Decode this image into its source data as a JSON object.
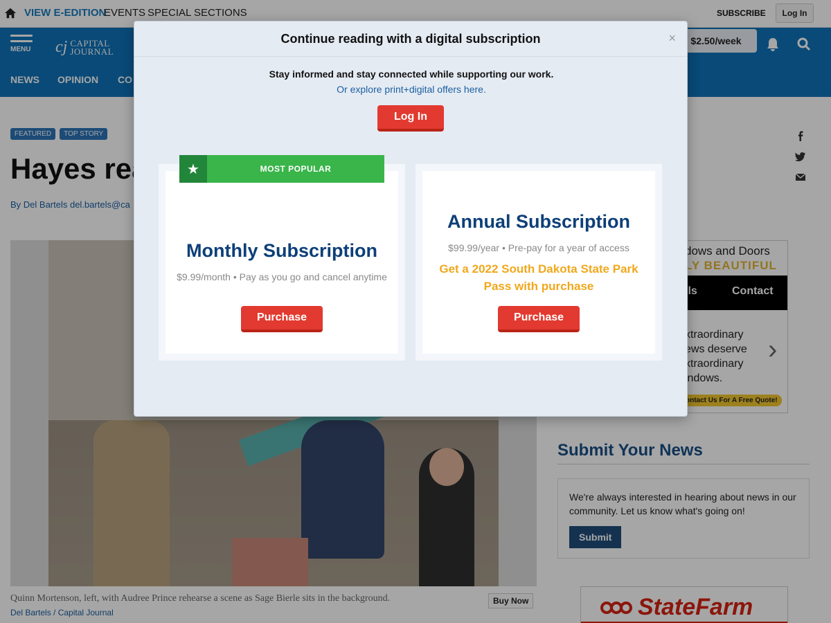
{
  "topbar": {
    "links": [
      "VIEW E-EDITION",
      "EVENTS",
      "SPECIAL SECTIONS"
    ],
    "subscribe": "SUBSCRIBE",
    "login": "Log In"
  },
  "header": {
    "menu_label": "MENU",
    "logo_mark": "cj",
    "logo_line1": "CAPITAL",
    "logo_line2": "JOURNAL",
    "nav": [
      "NEWS",
      "OPINION",
      "CO"
    ],
    "price": "$2.50/week"
  },
  "article": {
    "tags": [
      "FEATURED",
      "TOP STORY"
    ],
    "headline": "Hayes rea",
    "byline": "By Del Bartels del.bartels@ca",
    "caption": "Quinn Mortenson, left, with Audree Prince rehearse a scene as Sage Bierle sits in the background.",
    "credit": "Del Bartels / Capital Journal",
    "buy_now": "Buy Now"
  },
  "sidebar": {
    "ad": {
      "line1": "dows and Doors",
      "line2": "LY BEAUTIFUL",
      "details": "ils",
      "contact": "Contact",
      "copy": [
        "xtraordinary",
        "ews deserve",
        "xtraordinary",
        "indows."
      ],
      "quote": "ontact Us For A Free Quote!"
    },
    "submit_title": "Submit Your News",
    "submit_text": "We're always interested in hearing about news in our community. Let us know what's going on!",
    "submit_button": "Submit",
    "statefarm": "StateFarm"
  },
  "modal": {
    "title": "Continue reading with a digital subscription",
    "close": "×",
    "intro": "Stay informed and stay connected while supporting our work.",
    "offers_link": "Or explore print+digital offers here.",
    "login": "Log In",
    "popular_label": "MOST POPULAR",
    "popular_star": "★",
    "monthly": {
      "name": "Monthly Subscription",
      "desc": "$9.99/month • Pay as you go and cancel anytime",
      "button": "Purchase"
    },
    "annual": {
      "name": "Annual Subscription",
      "desc": "$99.99/year • Pre-pay for a year of access",
      "promo": "Get a 2022 South Dakota State Park Pass with purchase",
      "button": "Purchase"
    }
  },
  "colors": {
    "brand_blue": "#0e72b8",
    "button_red": "#e23a30",
    "popular_green": "#3ab54a",
    "promo_orange": "#f0a81c",
    "plan_title": "#0d3f78"
  }
}
